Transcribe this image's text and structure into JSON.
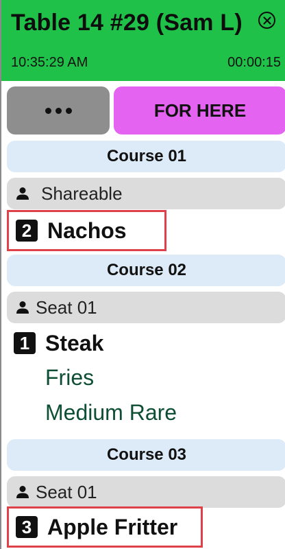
{
  "header": {
    "title": "Table 14 #29 (Sam L)",
    "time": "10:35:29 AM",
    "elapsed": "00:00:15",
    "close_icon": "close-icon",
    "background_color": "#1fc148"
  },
  "actions": {
    "more_icon": "ellipsis-icon",
    "dine_option": "FOR HERE",
    "dine_option_color": "#e463f0"
  },
  "courses": [
    {
      "label": "Course 01",
      "seat": "Shareable",
      "items": [
        {
          "qty": "2",
          "name": "Nachos",
          "highlighted": true,
          "modifiers": []
        }
      ]
    },
    {
      "label": "Course 02",
      "seat": "Seat 01",
      "items": [
        {
          "qty": "1",
          "name": "Steak",
          "highlighted": false,
          "modifiers": [
            "Fries",
            "Medium Rare"
          ]
        }
      ]
    },
    {
      "label": "Course 03",
      "seat": "Seat 01",
      "items": [
        {
          "qty": "3",
          "name": "Apple Fritter",
          "highlighted": true,
          "modifiers": []
        }
      ]
    }
  ],
  "colors": {
    "course_header": "#dcebf7",
    "seat_header": "#dcdcdc",
    "highlight_border": "#e04049",
    "modifier_text": "#0e4e34"
  }
}
